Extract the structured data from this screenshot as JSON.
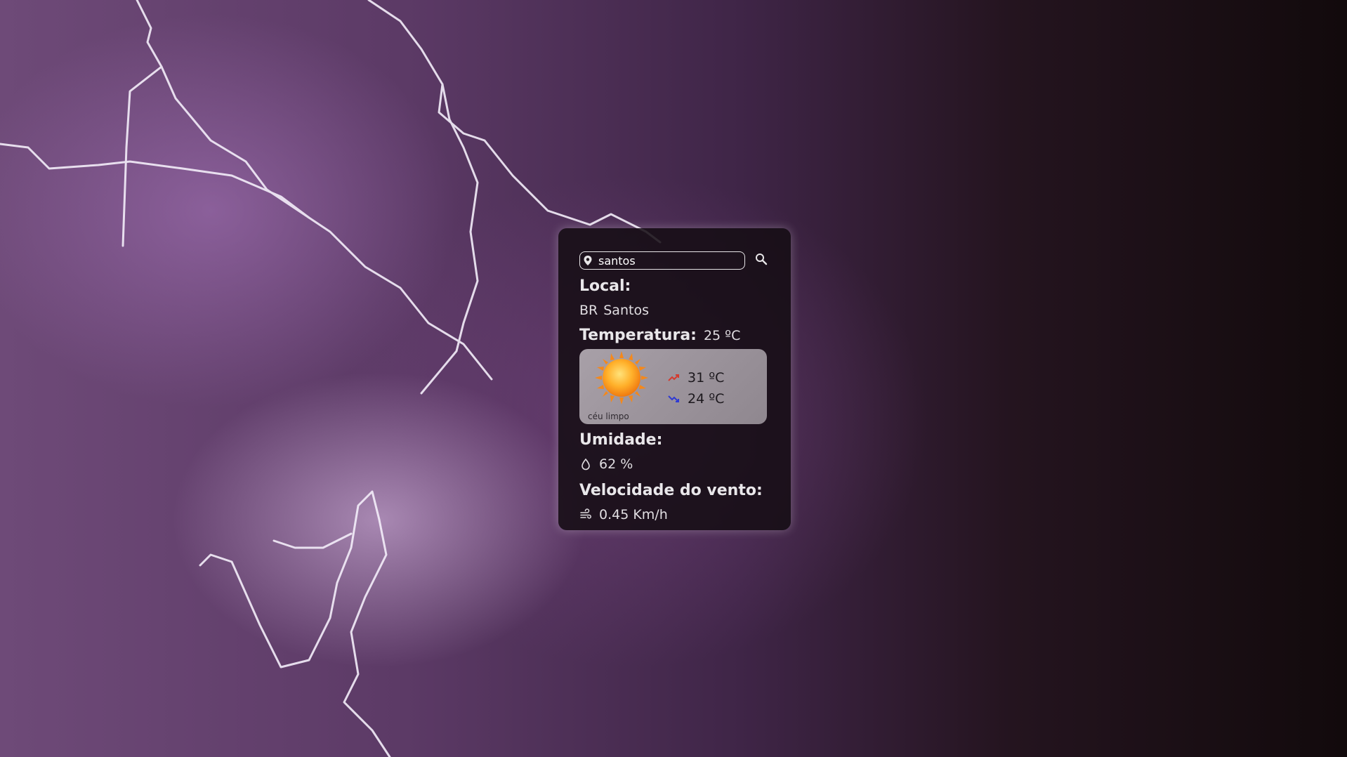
{
  "search": {
    "value": "santos",
    "pin_icon": "location-pin-icon",
    "button_icon": "search-icon"
  },
  "location": {
    "label": "Local:",
    "country": "BR",
    "city": "Santos"
  },
  "temperature": {
    "label": "Temperatura:",
    "value": "25 ºC",
    "max": "31 ºC",
    "min": "24 ºC",
    "max_icon": "trend-up-icon",
    "min_icon": "trend-down-icon",
    "weather_icon": "sun-icon",
    "description": "céu limpo"
  },
  "humidity": {
    "label": "Umidade:",
    "icon": "droplet-icon",
    "value": "62 %"
  },
  "wind": {
    "label": "Velocidade do vento:",
    "icon": "wind-icon",
    "value": "0.45 Km/h"
  },
  "colors": {
    "card_bg": "#160e14",
    "weather_box": "#a8a0a8",
    "max_arrow": "#d43a2f",
    "min_arrow": "#2f3ad4"
  }
}
